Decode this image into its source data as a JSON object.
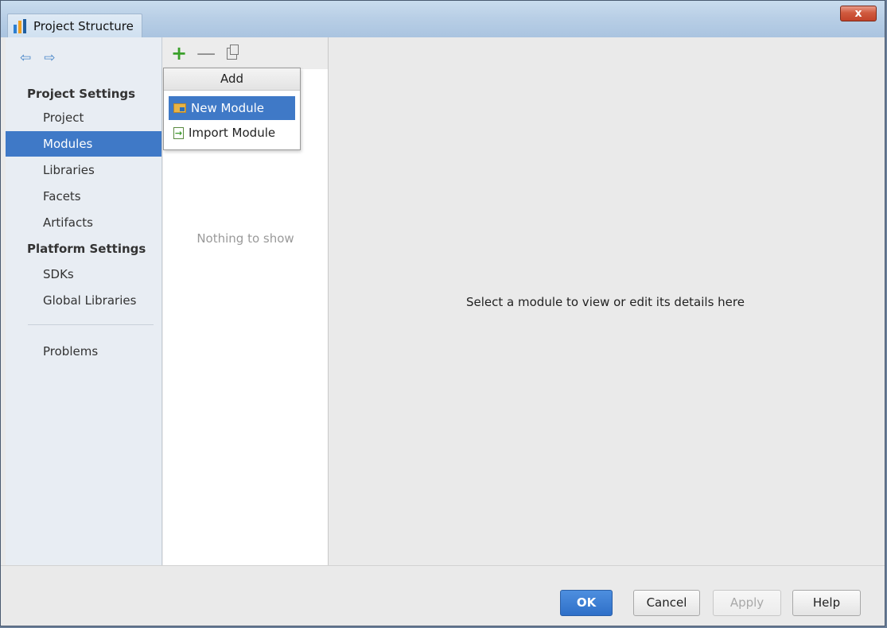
{
  "window": {
    "title": "Project Structure",
    "close_glyph": "x"
  },
  "nav": {
    "back_glyph": "⇦",
    "forward_glyph": "⇨"
  },
  "sidebar": {
    "project_settings_title": "Project Settings",
    "platform_settings_title": "Platform Settings",
    "items": [
      {
        "label": "Project"
      },
      {
        "label": "Modules"
      },
      {
        "label": "Libraries"
      },
      {
        "label": "Facets"
      },
      {
        "label": "Artifacts"
      },
      {
        "label": "SDKs"
      },
      {
        "label": "Global Libraries"
      },
      {
        "label": "Problems"
      }
    ],
    "selected": "Modules"
  },
  "toolbar": {
    "add_glyph": "+",
    "remove_glyph": "—"
  },
  "popup": {
    "header": "Add",
    "items": [
      {
        "label": "New Module"
      },
      {
        "label": "Import Module"
      }
    ]
  },
  "module_list": {
    "empty_text": "Nothing to show"
  },
  "details": {
    "placeholder": "Select a module to view or edit its details here"
  },
  "buttons": {
    "ok": "OK",
    "cancel": "Cancel",
    "apply": "Apply",
    "help": "Help"
  }
}
